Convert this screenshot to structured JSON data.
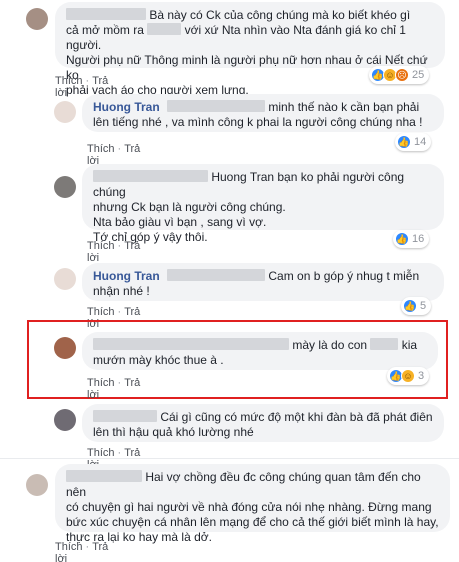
{
  "actions": {
    "like": "Thích",
    "reply": "Trả lời",
    "sep": "·"
  },
  "comments": [
    {
      "name": "",
      "text1": "Bà này có Ck của công chúng mà ko biết khéo gì",
      "text2a": "cả mở mồm ra",
      "text2b": "với xứ Nta nhìn vào Nta đánh giá ko chỉ 1 người.",
      "text3": "Người phụ nữ Thông minh là người phụ nữ hơn nhau ở cái Nết chứ ko",
      "text4": "phải vạch áo cho người xem lưng.",
      "reactions": "25"
    },
    {
      "name": "Huong Tran",
      "text1": "minh thế nào k cần bạn phải",
      "text2": "lên tiếng nhé , va mình công k phai la người công chúng nha !",
      "reactions": "14"
    },
    {
      "name": "",
      "text1": "Huong Tran bạn ko phải người công chúng",
      "text2": "nhưng Ck bạn là người công chúng.",
      "text3": "Nta bảo giàu vì bạn , sang vì vợ.",
      "text4": "Tớ chỉ góp ý vậy thôi.",
      "reactions": "16"
    },
    {
      "name": "Huong Tran",
      "text1": "Cam on b góp ý nhug t miễn",
      "text2": "nhận nhé !",
      "reactions": "5"
    },
    {
      "name": "",
      "text1a": "mày là do con",
      "text1b": "kia",
      "text2": "mướn mày khóc thue à .",
      "reactions": "3"
    },
    {
      "name": "",
      "text1": "Cái gì cũng có mức độ một khi đàn bà đã phát điên",
      "text2": "lên thì hậu quả khó lường nhé"
    },
    {
      "name": "",
      "text1": "Hai vợ chồng đều đc công chúng quan tâm đến cho nên",
      "text2": "có chuyện gì hai người về nhà đóng cửa nói nhẹ nhàng. Đừng mang",
      "text3": "bức xúc chuyện cá nhân lên mạng để cho cả thế giới biết mình là hay,",
      "text4": "thực ra lại ko hay mà là dở."
    }
  ],
  "icons": {
    "like": "like-icon",
    "haha": "haha-icon",
    "angry": "angry-icon"
  },
  "colors": {
    "name": "#385898",
    "bubble": "#f2f3f5",
    "highlight": "#e02020",
    "like": "#2d88ff"
  }
}
